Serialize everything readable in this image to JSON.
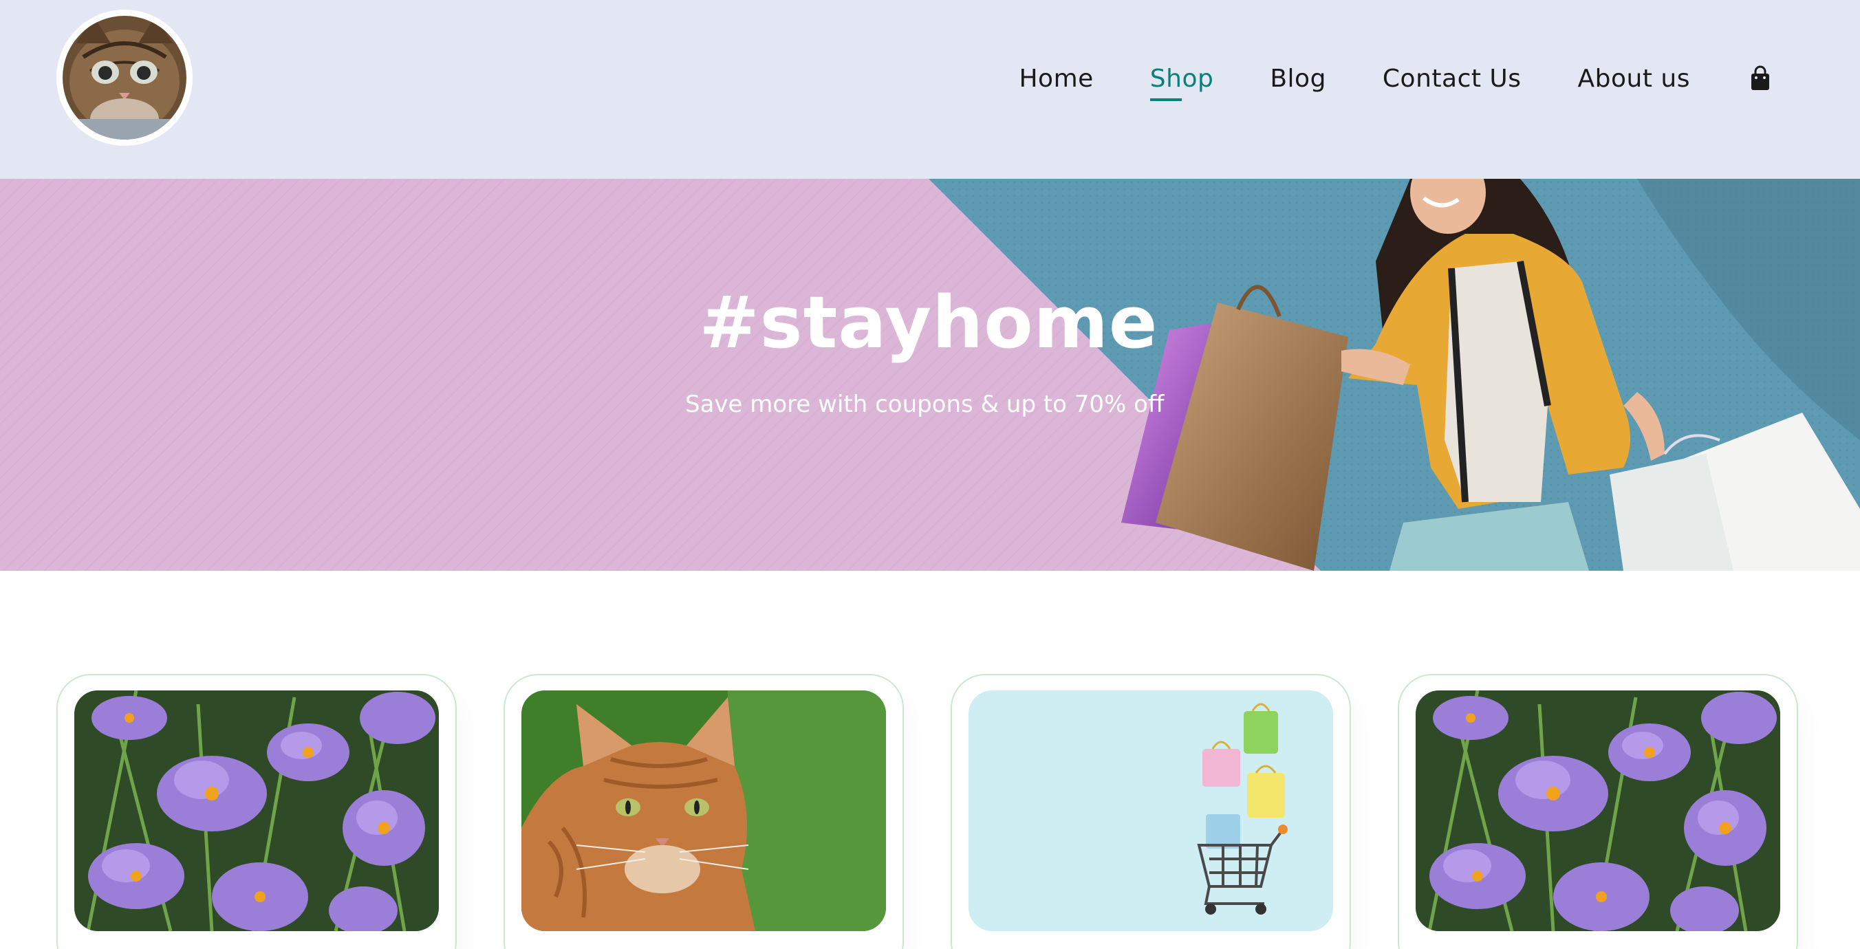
{
  "brand": {
    "logo_alt": "kitten logo"
  },
  "nav": {
    "items": [
      {
        "label": "Home",
        "active": false
      },
      {
        "label": "Shop",
        "active": true
      },
      {
        "label": "Blog",
        "active": false
      },
      {
        "label": "Contact Us",
        "active": false
      },
      {
        "label": "About us",
        "active": false
      }
    ],
    "cart_icon": "shopping-bag-icon"
  },
  "hero": {
    "title": "#stayhome",
    "subtitle": "Save more with coupons & up to 70% off"
  },
  "products": [
    {
      "image": "purple crocus flowers"
    },
    {
      "image": "orange tabby cat"
    },
    {
      "image": "shopping cart with colorful bags"
    },
    {
      "image": "purple crocus flowers"
    }
  ],
  "colors": {
    "header_bg": "#e3e6f3",
    "accent": "#088178",
    "hero_pink": "#dcb6d6",
    "hero_teal": "#5e9ab1",
    "card_border": "#cce7d0"
  }
}
